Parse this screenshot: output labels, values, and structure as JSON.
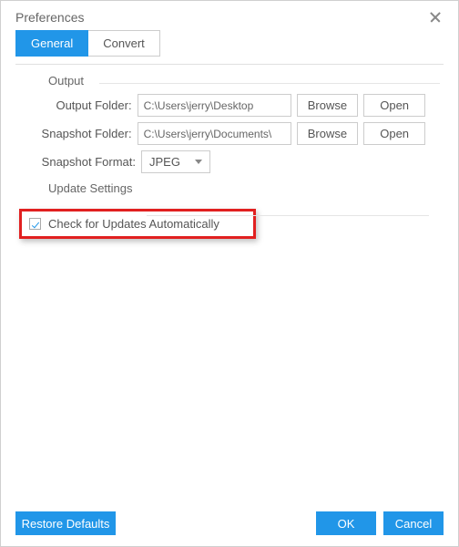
{
  "dialog": {
    "title": "Preferences"
  },
  "tabs": {
    "general": "General",
    "convert": "Convert"
  },
  "output": {
    "section_label": "Output",
    "output_folder_label": "Output Folder:",
    "output_folder_value": "C:\\Users\\jerry\\Desktop",
    "snapshot_folder_label": "Snapshot Folder:",
    "snapshot_folder_value": "C:\\Users\\jerry\\Documents\\",
    "snapshot_format_label": "Snapshot Format:",
    "snapshot_format_value": "JPEG",
    "browse": "Browse",
    "open": "Open"
  },
  "update": {
    "section_label": "Update Settings",
    "checkbox_label": "Check for Updates Automatically"
  },
  "footer": {
    "restore": "Restore Defaults",
    "ok": "OK",
    "cancel": "Cancel"
  }
}
